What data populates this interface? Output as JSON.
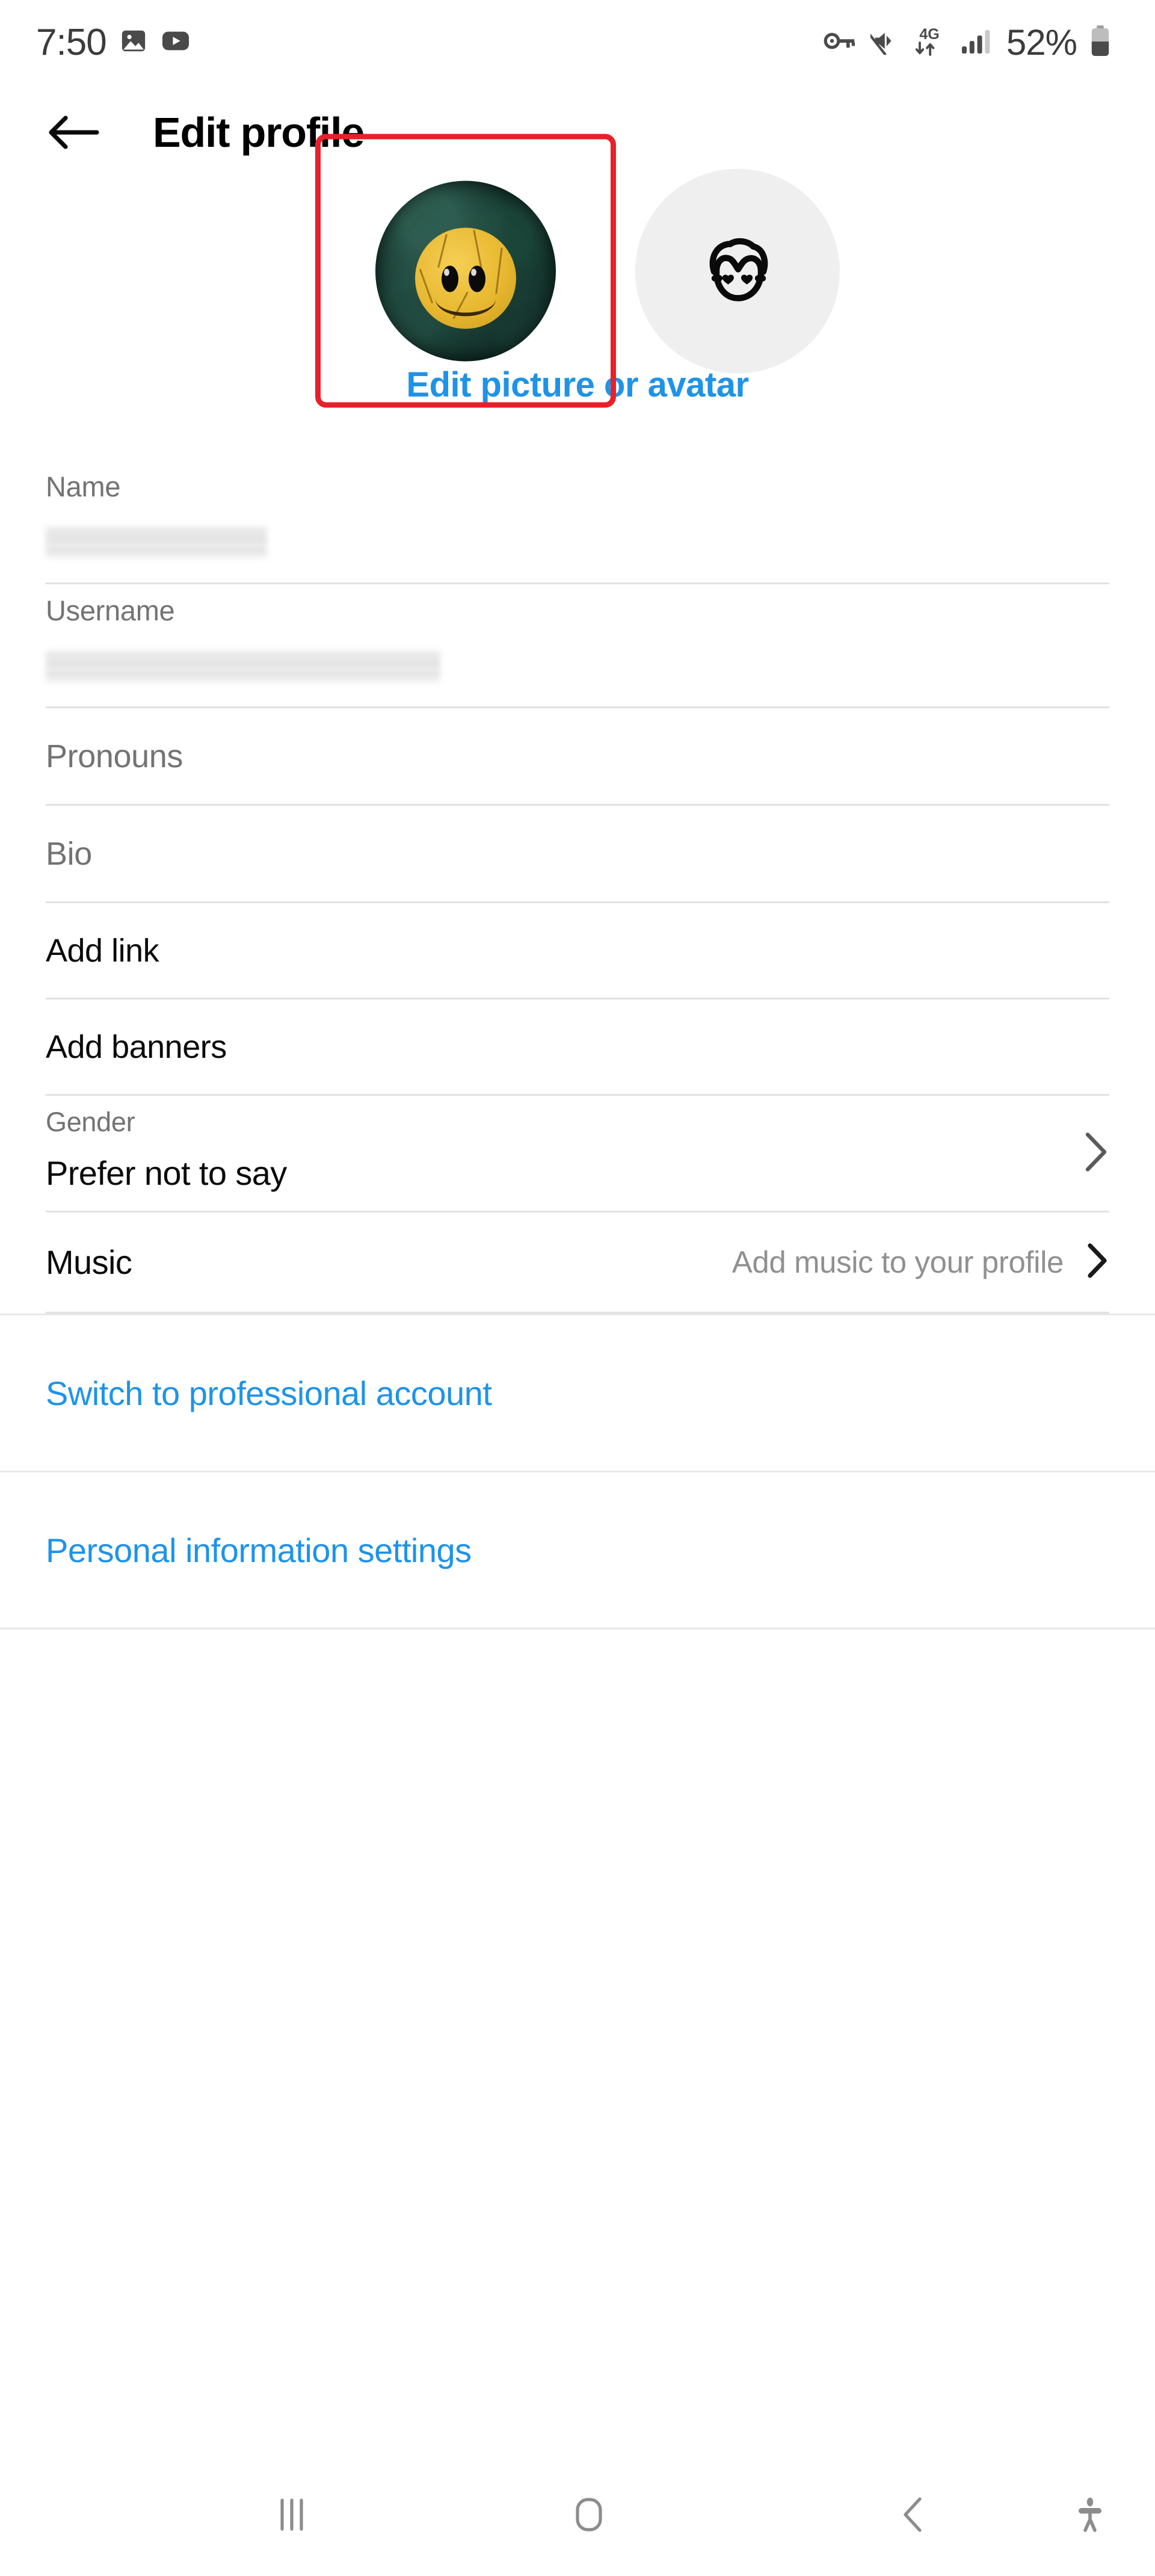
{
  "status_bar": {
    "clock": "7:50",
    "battery_percent": "52%",
    "left_icons": [
      "photos-icon",
      "youtube-icon"
    ],
    "right_icons": [
      "vpn-key-icon",
      "sound-muted-icon",
      "4g-data-icon",
      "signal-bars-icon",
      "battery-icon"
    ],
    "network_label": "4G",
    "text_color": "#3c3c3c"
  },
  "appbar": {
    "back_icon": "back-arrow-icon",
    "title": "Edit profile"
  },
  "avatar_picker": {
    "selected_option": "profile-photo",
    "selection_border_color": "#e8202a",
    "photo_alt": "smiley-face-profile-photo",
    "avatar_icon": "avatar-face-heart-eyes-icon",
    "avatar_bubble_color": "#efefef",
    "edit_link": "Edit picture or avatar",
    "link_color": "#1e93e8"
  },
  "form": {
    "fields": [
      {
        "label": "Name",
        "value": "",
        "redacted": true,
        "type": "labeled-input"
      },
      {
        "label": "Username",
        "value": "",
        "redacted": true,
        "type": "labeled-input"
      },
      {
        "placeholder": "Pronouns",
        "type": "placeholder-input"
      },
      {
        "placeholder": "Bio",
        "type": "placeholder-input"
      },
      {
        "label": "Add link",
        "type": "action"
      },
      {
        "label": "Add banners",
        "type": "action"
      },
      {
        "sub_label": "Gender",
        "value": "Prefer not to say",
        "type": "two-line-nav",
        "chevron": "chevron-right-icon"
      },
      {
        "label": "Music",
        "value": "Add music to your profile",
        "type": "inline-nav",
        "chevron": "chevron-right-icon"
      }
    ]
  },
  "bottom_links": [
    {
      "label": "Switch to professional account"
    },
    {
      "label": "Personal information settings"
    }
  ],
  "navbar": {
    "recents": "recents-icon",
    "home": "home-icon",
    "back": "back-icon",
    "accessibility": "accessibility-icon",
    "icon_color": "#8c8c8c"
  }
}
